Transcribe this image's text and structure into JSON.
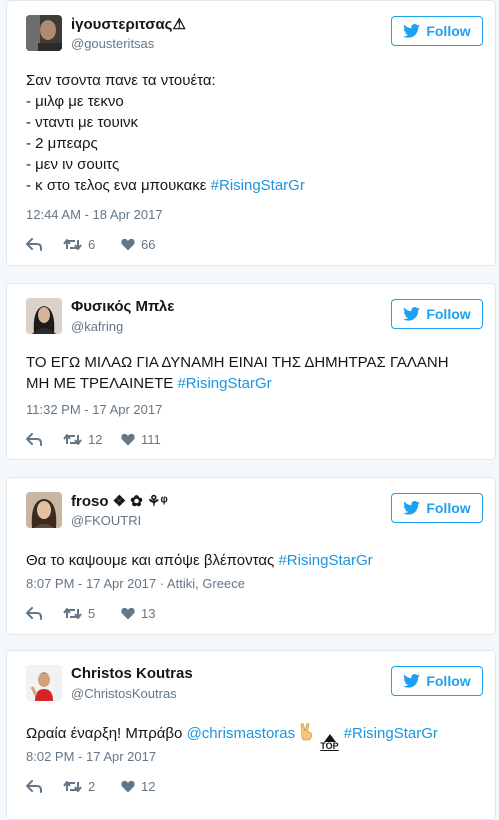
{
  "follow_label": "Follow",
  "colors": {
    "accent": "#1da1f2",
    "link": "#1b95e0",
    "muted": "#657786"
  },
  "tweets": [
    {
      "name": "ἰγουστεριτσας⚠",
      "handle": "@gousteritsas",
      "text_lines": [
        "Σαν τσοντα πανε τα ντουέτα:",
        "- μιλφ με τεκνο",
        "- νταντι με τουινκ",
        "- 2 μπεαρς",
        "- μεν ιν σουιτς",
        "- κ στο τελος ενα μπουκακε "
      ],
      "hashtag": "#RisingStarGr",
      "timestamp": "12:44 AM - 18 Apr 2017",
      "retweets": "6",
      "likes": "66"
    },
    {
      "name": "Φυσικός Μπλε",
      "handle": "@kafring",
      "text_lines": [
        "ΤΟ ΕΓΩ ΜΙΛΑΩ ΓΙΑ ΔΥΝΑΜΗ ΕΙΝΑΙ ΤΗΣ ΔΗΜΗΤΡΑΣ ΓΑΛΑΝΗ",
        "ΜΗ ΜΕ ΤΡΕΛΑΙΝΕΤΕ "
      ],
      "hashtag": "#RisingStarGr",
      "timestamp": "11:32 PM - 17 Apr 2017",
      "retweets": "12",
      "likes": "111"
    },
    {
      "name": "froso ❖ ✿ ⚘ᵠ",
      "handle": "@FKOUTRI",
      "text_lines": [
        "Θα το καψουμε και απόψε βλέποντας "
      ],
      "hashtag": "#RisingStarGr",
      "timestamp": "8:07 PM - 17 Apr 2017",
      "location": " · Attiki, Greece",
      "retweets": "5",
      "likes": "13"
    },
    {
      "name": "Christos Koutras",
      "handle": "@ChristosKoutras",
      "text_before": "Ωραία έναρξη! Μπράβο ",
      "mention": "@chrismastoras",
      "emoji_top_label": "TOP",
      "hashtag": "#RisingStarGr",
      "timestamp": "8:02 PM - 17 Apr 2017",
      "retweets": "2",
      "likes": "12"
    }
  ]
}
